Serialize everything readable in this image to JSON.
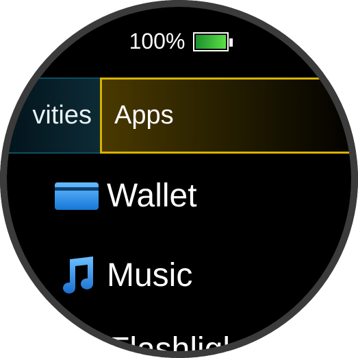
{
  "status": {
    "battery_percent": "100%",
    "battery_level": 1.0,
    "battery_color": "#3ecb3b"
  },
  "tabs": {
    "previous_label": "vities",
    "active_label": "Apps"
  },
  "menu": {
    "items": [
      {
        "label": "Wallet",
        "icon": "wallet-icon"
      },
      {
        "label": "Music",
        "icon": "music-note-icon"
      },
      {
        "label": "Flashligl",
        "icon": ""
      }
    ]
  },
  "colors": {
    "active_tab_border": "#d8b300",
    "inactive_tab_border": "#0b5060",
    "icon_blue": "#2f8fe8"
  }
}
